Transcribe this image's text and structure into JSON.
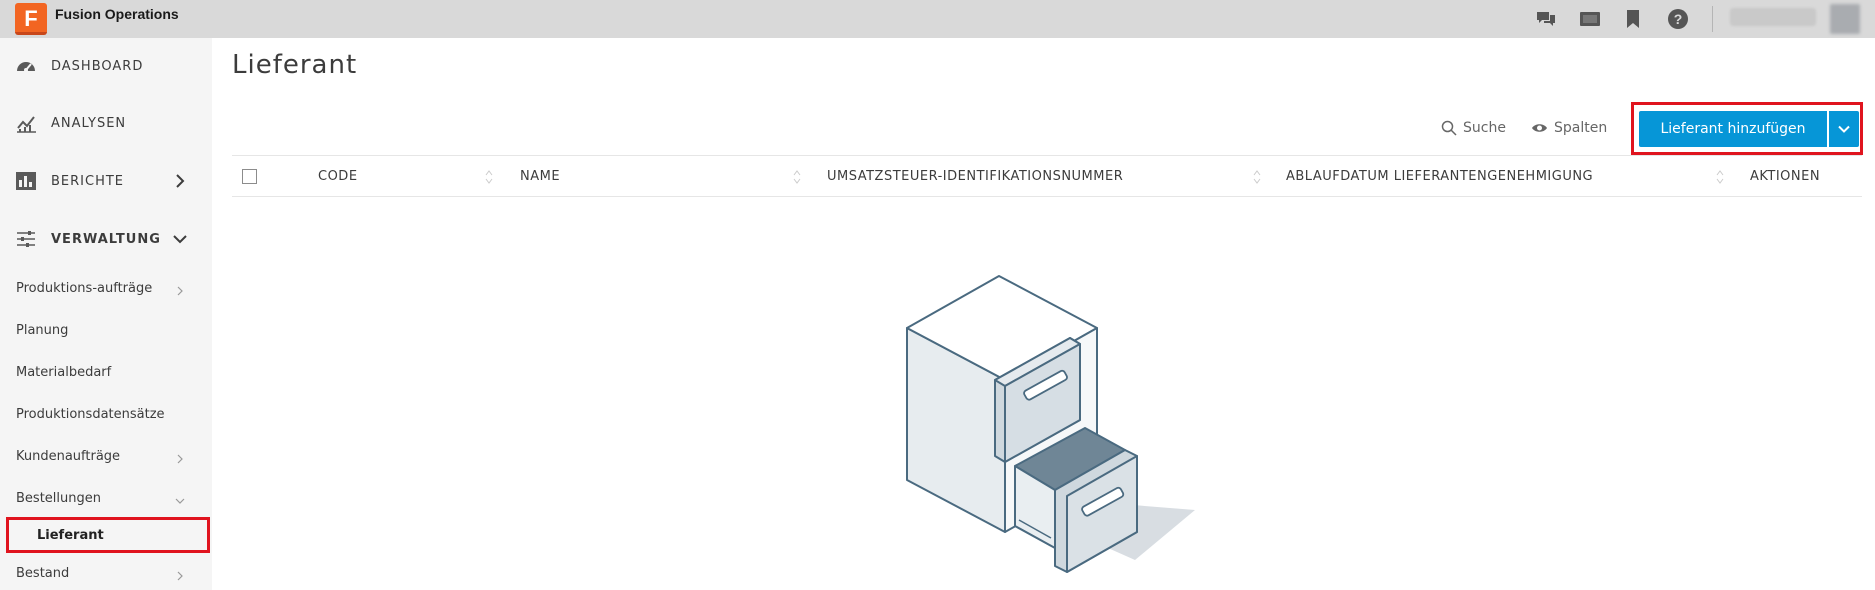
{
  "app": {
    "title": "Fusion Operations",
    "logo_letter": "F"
  },
  "sidebar": {
    "main_items": [
      {
        "label": "DASHBOARD"
      },
      {
        "label": "ANALYSEN"
      },
      {
        "label": "BERICHTE"
      },
      {
        "label": "VERWALTUNG"
      }
    ],
    "sub_items": [
      {
        "label": "Produktions-aufträge"
      },
      {
        "label": "Planung"
      },
      {
        "label": "Materialbedarf"
      },
      {
        "label": "Produktionsdatensätze"
      },
      {
        "label": "Kundenaufträge"
      },
      {
        "label": "Bestellungen"
      },
      {
        "label": "Lieferant"
      },
      {
        "label": "Bestand"
      }
    ]
  },
  "page": {
    "title": "Lieferant"
  },
  "toolbar": {
    "search_label": "Suche",
    "columns_label": "Spalten",
    "add_label": "Lieferant hinzufügen"
  },
  "table": {
    "columns": [
      "CODE",
      "NAME",
      "UMSATZSTEUER-IDENTIFIKATIONSNUMMER",
      "ABLAUFDATUM LIEFERANTENGENEHMIGUNG",
      "AKTIONEN"
    ],
    "rows": []
  },
  "colors": {
    "accent": "#0696d7",
    "highlight": "#e0141e",
    "brand": "#f26522"
  }
}
